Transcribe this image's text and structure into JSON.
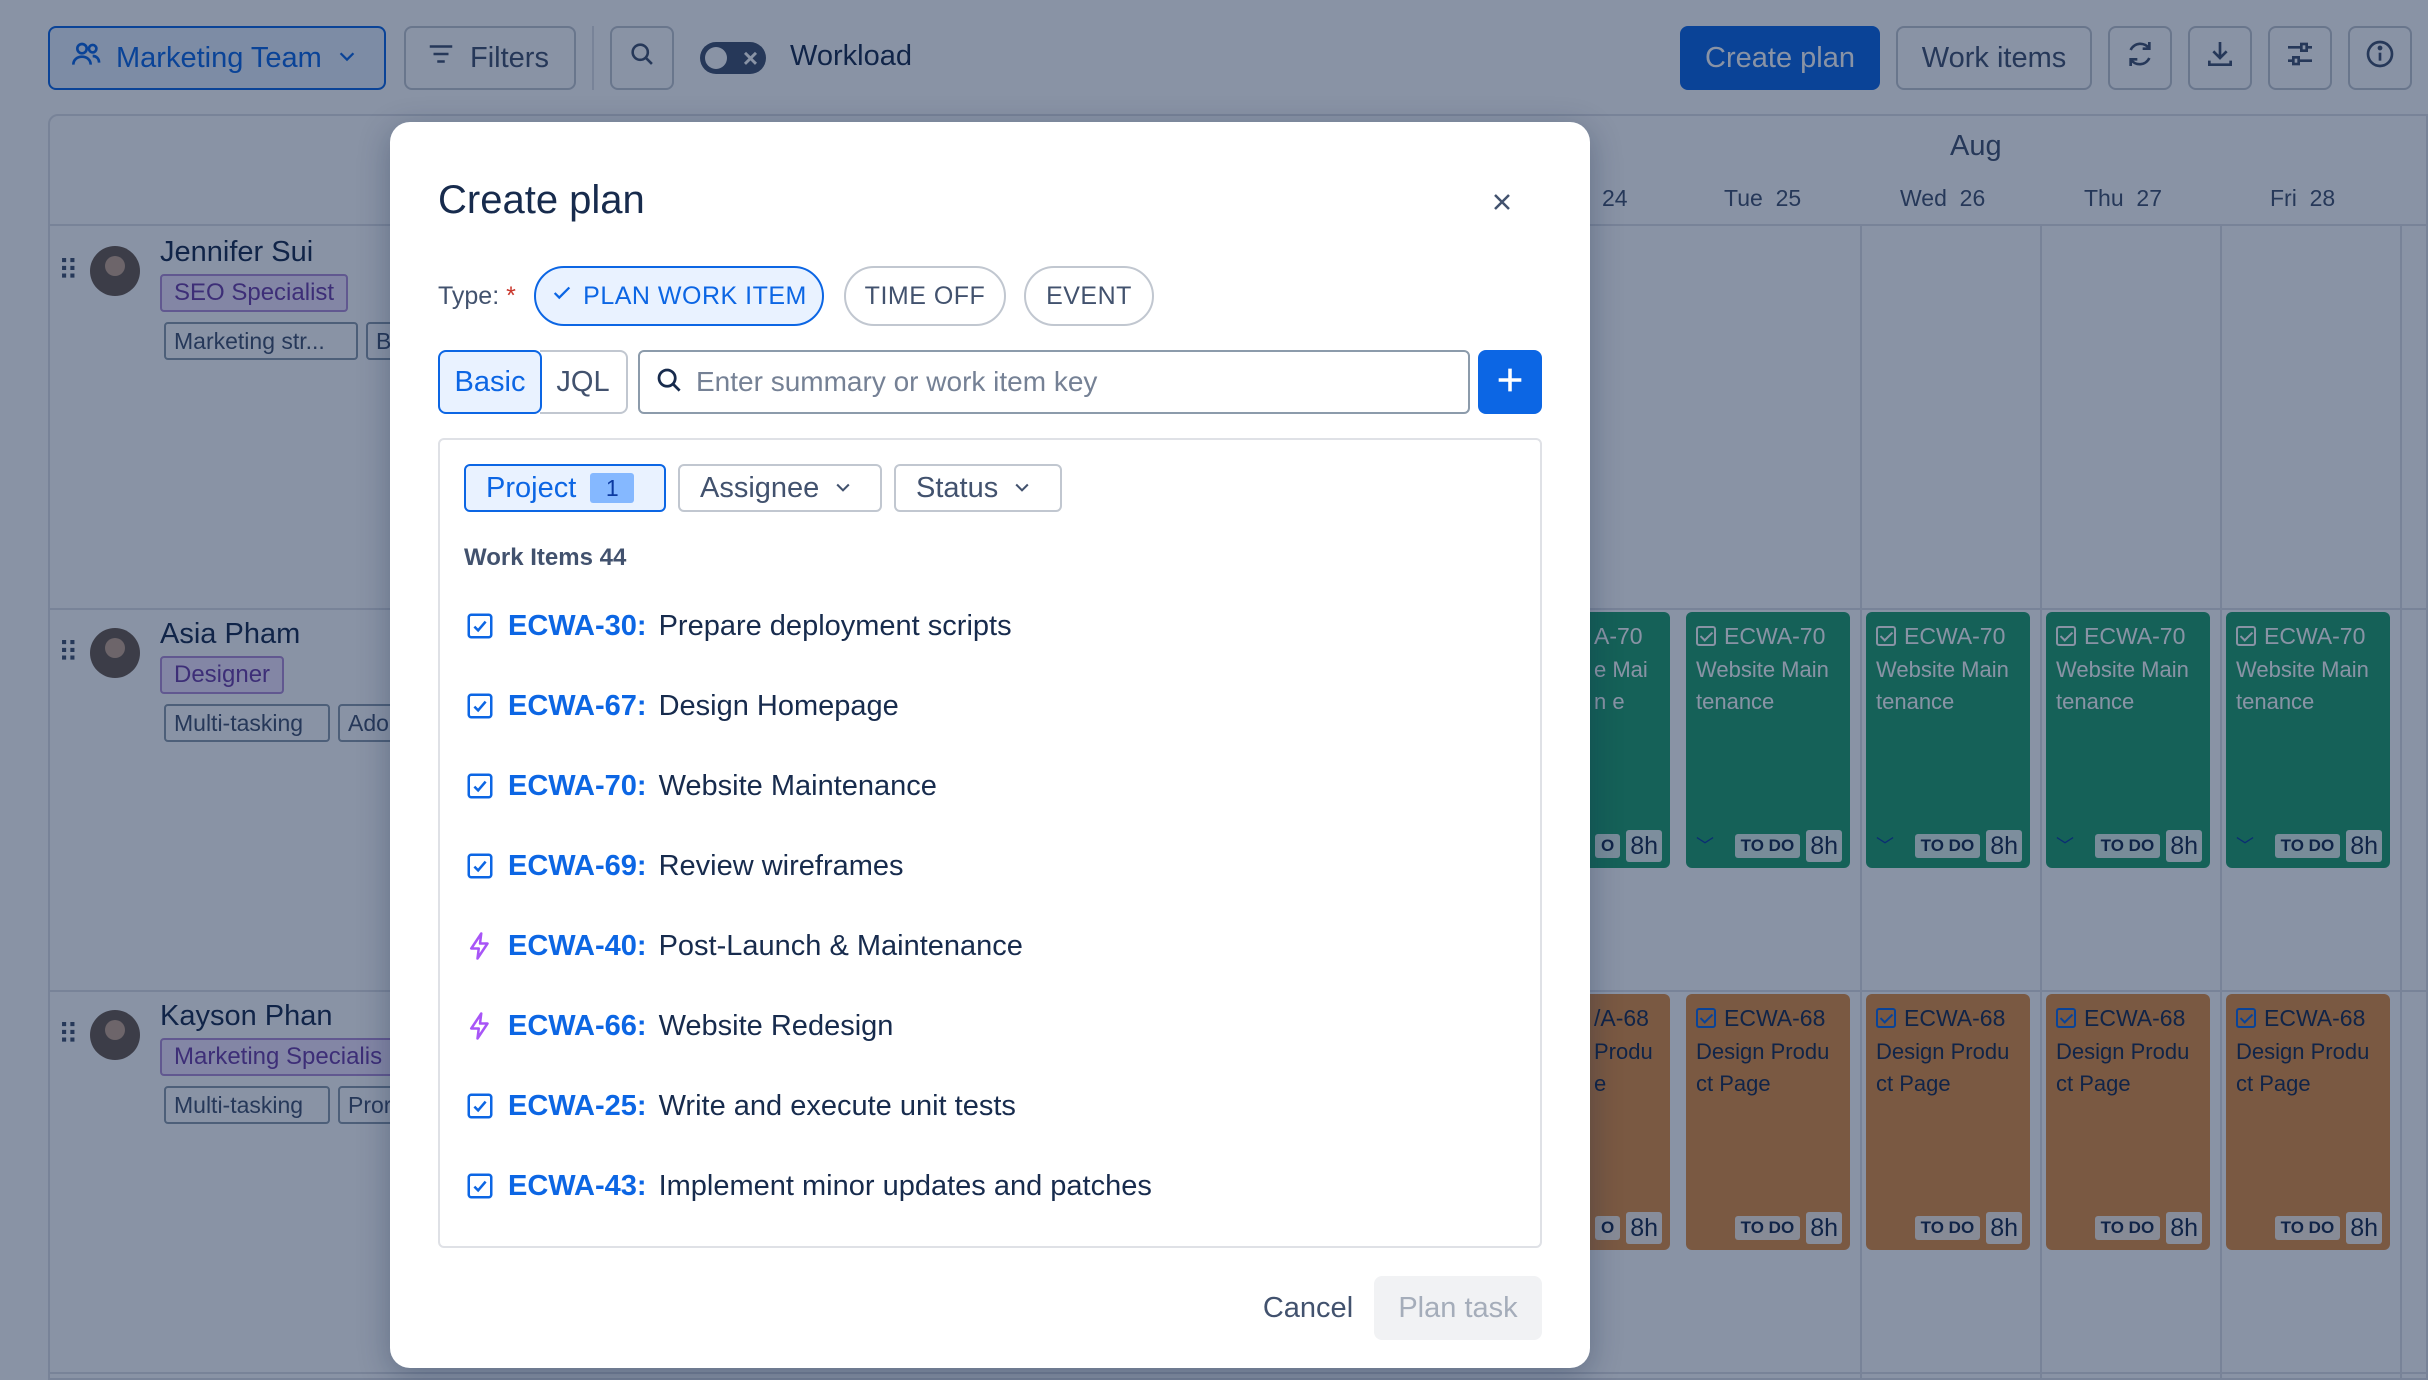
{
  "toolbar": {
    "team_label": "Marketing Team",
    "filters_label": "Filters",
    "workload_label": "Workload",
    "create_plan_label": "Create plan",
    "work_items_label": "Work items"
  },
  "calendar": {
    "month": "Aug",
    "days": [
      {
        "dow": "",
        "num": "24"
      },
      {
        "dow": "Tue",
        "num": "25"
      },
      {
        "dow": "Wed",
        "num": "26"
      },
      {
        "dow": "Thu",
        "num": "27"
      },
      {
        "dow": "Fri",
        "num": "28"
      }
    ]
  },
  "people": [
    {
      "name": "Jennifer Sui",
      "role": "SEO Specialist",
      "skills": [
        "Marketing str...",
        "B"
      ]
    },
    {
      "name": "Asia Pham",
      "role": "Designer",
      "skills": [
        "Multi-tasking",
        "Ado"
      ]
    },
    {
      "name": "Kayson Phan",
      "role": "Marketing Specialis",
      "skills": [
        "Multi-tasking",
        "Pror"
      ]
    }
  ],
  "cards": {
    "green": {
      "key": "ECWA-70",
      "summary": "Website Main tenance",
      "summary_partial": "e Main e",
      "key_partial": "A-70",
      "status": "TO DO",
      "hours": "8h",
      "status_partial": "O"
    },
    "orange": {
      "key": "ECWA-68",
      "summary": "Design Produ ct Page",
      "summary_partial": "Produ e",
      "key_partial": "/A-68",
      "status": "TO DO",
      "hours": "8h",
      "status_partial": "O"
    }
  },
  "modal": {
    "title": "Create plan",
    "type_label": "Type:",
    "required_mark": "*",
    "types": [
      "PLAN WORK ITEM",
      "TIME OFF",
      "EVENT"
    ],
    "search_modes": [
      "Basic",
      "JQL"
    ],
    "search_placeholder": "Enter summary or work item key",
    "filters": {
      "project_label": "Project",
      "project_count": "1",
      "assignee_label": "Assignee",
      "status_label": "Status"
    },
    "work_items_header": "Work Items 44",
    "work_items": [
      {
        "key": "ECWA-30:",
        "summary": "Prepare deployment scripts",
        "icon": "task-checkbox-icon"
      },
      {
        "key": "ECWA-67:",
        "summary": "Design Homepage",
        "icon": "task-checkbox-icon"
      },
      {
        "key": "ECWA-70:",
        "summary": "Website Maintenance",
        "icon": "task-checkbox-icon"
      },
      {
        "key": "ECWA-69:",
        "summary": "Review wireframes",
        "icon": "task-checkbox-icon"
      },
      {
        "key": "ECWA-40:",
        "summary": "Post-Launch & Maintenance",
        "icon": "epic-lightning-icon"
      },
      {
        "key": "ECWA-66:",
        "summary": "Website Redesign",
        "icon": "epic-lightning-icon"
      },
      {
        "key": "ECWA-25:",
        "summary": "Write and execute unit tests",
        "icon": "task-checkbox-icon"
      },
      {
        "key": "ECWA-43:",
        "summary": "Implement minor updates and patches",
        "icon": "task-checkbox-icon"
      }
    ],
    "cancel_label": "Cancel",
    "plan_task_label": "Plan task"
  },
  "colors": {
    "accent": "#0c66e4",
    "card_green": "#22a06b",
    "card_orange": "#e29142",
    "epic_purple": "#a855f7"
  }
}
